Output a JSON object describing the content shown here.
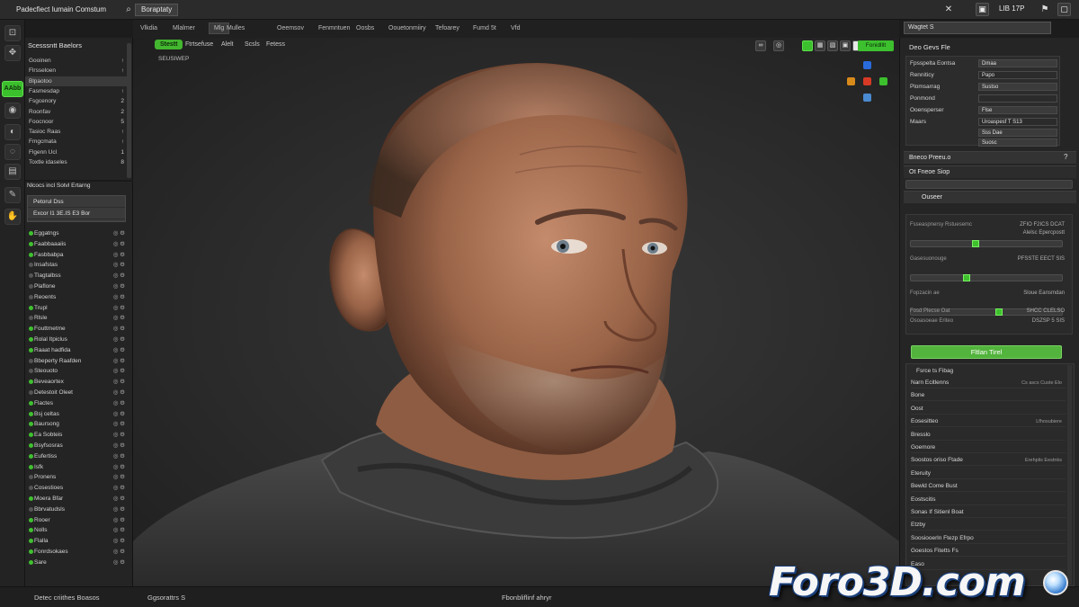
{
  "app": {
    "title": "Padecfiect Iumain Comstum",
    "project": "Boraptaty",
    "right_label": "LIB 17P"
  },
  "menubar": {
    "items": [
      "Vlkdia",
      "Mlalmer",
      "Mlg",
      "Mulles",
      "Oeemsov",
      "Fenmntuen",
      "Oosbs",
      "Oouetonmiiry",
      "Tefoarey",
      "Fumd",
      "5t",
      "Vfd"
    ]
  },
  "toolstrip": {
    "active_label": "AAbb"
  },
  "outliner": {
    "header": "Scesssntt Baelors",
    "rows": [
      {
        "label": "Gooinen",
        "n": "↑"
      },
      {
        "label": "Flrsseloen",
        "n": "↑"
      },
      {
        "label": "Blpaotoo",
        "n": ""
      },
      {
        "label": "Fasmesdap",
        "n": "↑"
      },
      {
        "label": "Fsgcenory",
        "n": "2"
      },
      {
        "label": "Roonfav",
        "n": "2"
      },
      {
        "label": "Foocnoor",
        "n": "5"
      },
      {
        "label": "Tasioc Raas",
        "n": "↑"
      },
      {
        "label": "Fmgcmata",
        "n": "↑"
      },
      {
        "label": "Flgenn Ucl",
        "n": "1"
      },
      {
        "label": "Toxtle idaseles",
        "n": "8"
      }
    ],
    "layers_header": "Nlcocs incl Sotvl Ertarng",
    "layers_box": [
      "Petorul Dss",
      "Excor I1 3E.IS E3 Bor"
    ],
    "layers": [
      {
        "label": "Eggatngs",
        "on": true
      },
      {
        "label": "Faabbaaaiis",
        "on": true
      },
      {
        "label": "Fasbbabpa",
        "on": true
      },
      {
        "label": "Insafstas",
        "on": false
      },
      {
        "label": "Tlagtalbss",
        "on": false
      },
      {
        "label": "Plaflone",
        "on": false
      },
      {
        "label": "Reoents",
        "on": false
      },
      {
        "label": "Trupl",
        "on": true
      },
      {
        "label": "Rlsle",
        "on": false
      },
      {
        "label": "Fouttmetme",
        "on": true
      },
      {
        "label": "Rolal Itpiclus",
        "on": true
      },
      {
        "label": "Raaat hadfida",
        "on": true
      },
      {
        "label": "Bbeperty Raafden",
        "on": false
      },
      {
        "label": "Steouoto",
        "on": false
      },
      {
        "label": "Beveaortex",
        "on": true
      },
      {
        "label": "Detestoit Oleet",
        "on": false
      },
      {
        "label": "Flactes",
        "on": true
      },
      {
        "label": "Bsj celtas",
        "on": true
      },
      {
        "label": "Baursong",
        "on": true
      },
      {
        "label": "Ea Sobteis",
        "on": true
      },
      {
        "label": "Bsyfsosras",
        "on": true
      },
      {
        "label": "Eufertiss",
        "on": true
      },
      {
        "label": "Isfk",
        "on": true
      },
      {
        "label": "Pronens",
        "on": false
      },
      {
        "label": "Cosestioes",
        "on": false
      },
      {
        "label": "Moera Bfar",
        "on": true
      },
      {
        "label": "Bbrvatudsls",
        "on": false
      },
      {
        "label": "Rooer",
        "on": true
      },
      {
        "label": "Nolls",
        "on": true
      },
      {
        "label": "Flalla",
        "on": true
      },
      {
        "label": "Fonrdsokaes",
        "on": true
      },
      {
        "label": "Sare",
        "on": true
      }
    ]
  },
  "viewport": {
    "tabs": [
      "Stestt",
      "Ftrtsefuse",
      "Alelt",
      "Scsls",
      "Fetess"
    ],
    "sub_label": "SEUSIWEP"
  },
  "rightpanel": {
    "header": "Deo Gevs Fle",
    "search_value": "Wagtet S",
    "top_button": "Fonidlllt",
    "props": [
      {
        "label": "Fpsspelta Eontsa",
        "value": "Dmaa"
      },
      {
        "label": "Renniticy",
        "value": "Papo"
      },
      {
        "label": "Plomsarrag",
        "value": "Sustso"
      },
      {
        "label": "Ponmond",
        "value": ""
      },
      {
        "label": "Ooensperser",
        "value": "Flse"
      },
      {
        "label": "Maars",
        "value": "Uroaspesf T S13"
      }
    ],
    "extra_cells": [
      "Sss Dae",
      "Suosc"
    ],
    "section1": "Bneco Preeu.o",
    "section2": "Ot Fneoe Siop",
    "section3": "Ouseer",
    "sliders": [
      {
        "label": "Fsseaspnersy Rstuesemc",
        "right": "ZFIO F2ICS DCAT",
        "sub": "Alelsc Epercpostt",
        "pos": 0.42
      },
      {
        "label": "Gasesuonouge",
        "right": "PFSSTE EECT SIS",
        "sub": "",
        "pos": 0.36
      },
      {
        "label": "Fopzacin ae",
        "right": "Sloue Eansmdan",
        "sub": "",
        "pos": 0.58
      }
    ],
    "slider_tail": [
      {
        "label": "Fosd Plecse Oat",
        "right": "SHCC CLELSO"
      },
      {
        "label": "Osoasoeae Eriteo",
        "right": "DSZSP 5 SIS"
      }
    ],
    "green_button": "Fltlan Tirel",
    "materials_header": "Fsrce ts Fibag",
    "materials": [
      {
        "label": "Narn Ecitlenns",
        "right": "Cs ascs Custe Elo"
      },
      {
        "label": "Bone",
        "right": ""
      },
      {
        "label": "Oost",
        "right": ""
      },
      {
        "label": "Eosesitteo",
        "right": "Lfhosubiere"
      },
      {
        "label": "Bresslo",
        "right": ""
      },
      {
        "label": "Goemore",
        "right": ""
      },
      {
        "label": "Soostos oriso Ftade",
        "right": "Erehplis Eestnks"
      },
      {
        "label": "Eteruity",
        "right": ""
      },
      {
        "label": "Bewld Come Bust",
        "right": ""
      },
      {
        "label": "Eostscitis",
        "right": ""
      },
      {
        "label": "Sonas If Sitienl Boat",
        "right": ""
      },
      {
        "label": "Etzby",
        "right": ""
      },
      {
        "label": "Soosiooerln Ftezp Efrpo",
        "right": ""
      },
      {
        "label": "Goestos Fitetts Fs",
        "right": ""
      },
      {
        "label": "Easo",
        "right": ""
      }
    ]
  },
  "statusbar": {
    "left": "Detec criithes Boasos",
    "middle_left": "Ggsorattrs S",
    "center": "Fbonbliflinf ahryr"
  },
  "watermark": {
    "text": "Foro3D.com"
  }
}
